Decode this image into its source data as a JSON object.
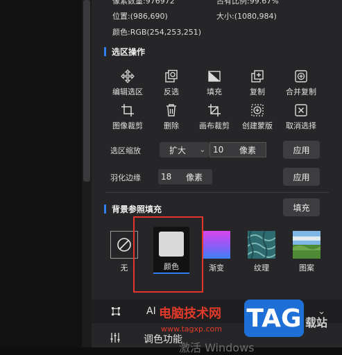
{
  "info": {
    "cut_left": "像素数量:976972",
    "cut_right": "占有比例:99.67%",
    "position": "位置:(986,690)",
    "size": "大小:(1080,984)",
    "color": "颜色:RGB(254,253,251)"
  },
  "selection_ops": {
    "title": "选区操作",
    "tools": [
      {
        "label": "编辑选区",
        "icon": "move-arrows-icon"
      },
      {
        "label": "反选",
        "icon": "invert-selection-icon"
      },
      {
        "label": "填充",
        "icon": "fill-icon"
      },
      {
        "label": "复制",
        "icon": "copy-icon"
      },
      {
        "label": "合并复制",
        "icon": "merge-copy-icon"
      },
      {
        "label": "图像裁剪",
        "icon": "image-crop-icon"
      },
      {
        "label": "删除",
        "icon": "trash-icon"
      },
      {
        "label": "画布裁剪",
        "icon": "canvas-crop-icon"
      },
      {
        "label": "创建蒙版",
        "icon": "create-mask-icon"
      },
      {
        "label": "取消选择",
        "icon": "cancel-selection-icon"
      }
    ],
    "scale_label": "选区缩放",
    "scale_mode": "扩大",
    "scale_value": "10",
    "scale_unit": "像素",
    "apply_label": "应用",
    "feather_label": "羽化边缘",
    "feather_value": "18",
    "feather_unit": "像素",
    "feather_apply_label": "应用"
  },
  "bg_fill": {
    "title": "背景参照填充",
    "fill_button": "填充",
    "options": [
      {
        "label": "无",
        "icon": "no-fill-icon"
      },
      {
        "label": "颜色",
        "icon": "color-swatch-icon",
        "selected": true
      },
      {
        "label": "渐变",
        "icon": "gradient-swatch-icon"
      },
      {
        "label": "纹理",
        "icon": "texture-swatch-icon"
      },
      {
        "label": "图案",
        "icon": "pattern-swatch-icon"
      }
    ]
  },
  "bottom": {
    "ai_label": "AI",
    "adjust_label": "调色功能",
    "win_ghost": "激活 Windows"
  },
  "watermark": {
    "text": "电脑技术网",
    "url": "www.tagxp.com",
    "tag": "TAG",
    "side": "载站"
  },
  "colors": {
    "accent": "#2f7ff0",
    "panel": "#262628",
    "highlight": "#e5362d"
  }
}
